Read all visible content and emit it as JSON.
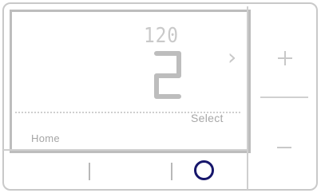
{
  "display": {
    "small_readout": "120",
    "main_digit": "2",
    "select_label": "Select",
    "home_label": "Home"
  },
  "icons": {
    "next": "chevron-right-icon",
    "plus": "plus-icon",
    "minus": "minus-icon",
    "circle": "circle-icon"
  },
  "colors": {
    "accent": "#16166b",
    "display_text": "#a7a7a7",
    "outline": "#c9c9c9"
  }
}
